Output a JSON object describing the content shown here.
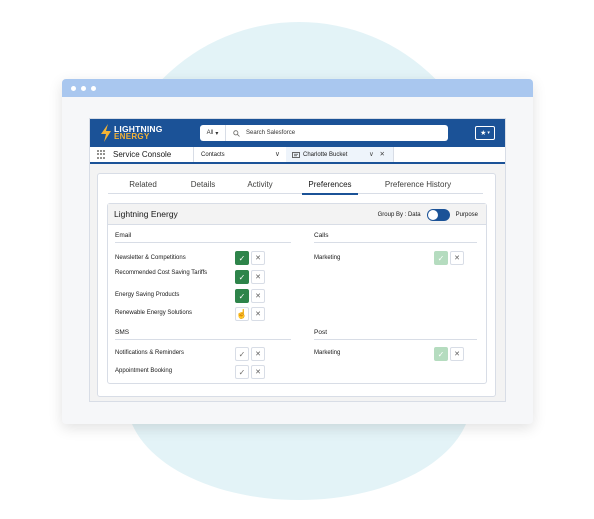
{
  "header": {
    "logo_line1": "LIGHTNING",
    "logo_line2": "ENERGY",
    "search_scope": "All",
    "search_placeholder": "Search Salesforce"
  },
  "console": {
    "title": "Service Console",
    "nav_item": "Contacts",
    "open_tab": "Charlotte Bucket"
  },
  "tabs": [
    {
      "label": "Related"
    },
    {
      "label": "Details"
    },
    {
      "label": "Activity"
    },
    {
      "label": "Preferences"
    },
    {
      "label": "Preference History"
    }
  ],
  "active_tab": "Preferences",
  "preferences": {
    "title": "Lightning Energy",
    "group_by_label": "Group By : Data",
    "group_by_option": "Purpose",
    "sections": {
      "email": {
        "title": "Email",
        "items": [
          {
            "label": "Newsletter & Competitions",
            "state": "on"
          },
          {
            "label": "Recommended Cost Saving Tariffs",
            "state": "on"
          },
          {
            "label": "Energy Saving Products",
            "state": "on"
          },
          {
            "label": "Renewable Energy Solutions",
            "state": "cursor"
          }
        ]
      },
      "calls": {
        "title": "Calls",
        "items": [
          {
            "label": "Marketing",
            "state": "soft"
          }
        ]
      },
      "sms": {
        "title": "SMS",
        "items": [
          {
            "label": "Notifications & Reminders",
            "state": "off"
          },
          {
            "label": "Appointment Booking",
            "state": "off"
          }
        ]
      },
      "post": {
        "title": "Post",
        "items": [
          {
            "label": "Marketing",
            "state": "soft"
          }
        ]
      }
    }
  },
  "colors": {
    "brand": "#1b5297",
    "accent": "#f5b335",
    "opt_in": "#2e844a",
    "opt_in_soft": "#b5dcbf"
  },
  "icons": {
    "check": "check-icon",
    "close": "close-icon",
    "cursor": "hand-pointer-icon"
  }
}
